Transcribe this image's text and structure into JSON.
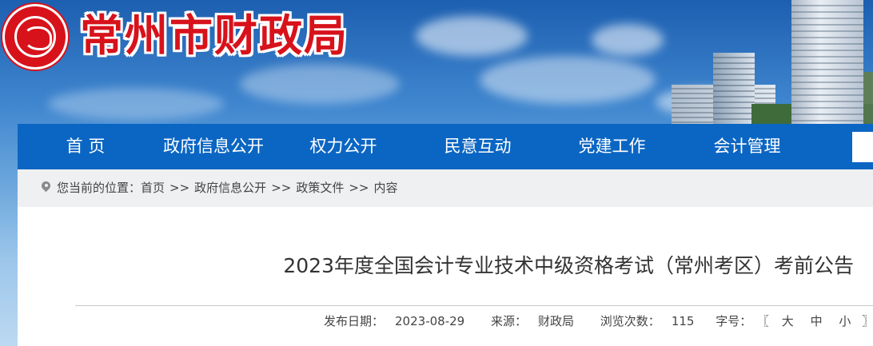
{
  "site": {
    "title": "常州市财政局",
    "logo": "dragon-seal-logo"
  },
  "nav": {
    "items": [
      {
        "label": "首 页"
      },
      {
        "label": "政府信息公开"
      },
      {
        "label": "权力公开"
      },
      {
        "label": "民意互动"
      },
      {
        "label": "党建工作"
      },
      {
        "label": "会计管理"
      }
    ],
    "color": "#0b66c3"
  },
  "breadcrumb": {
    "prefix": "您当前的位置：",
    "items": [
      "首页",
      "政府信息公开",
      "政策文件",
      "内容"
    ],
    "separator": ">>",
    "icon": "location-pin-icon"
  },
  "article": {
    "title": "2023年度全国会计专业技术中级资格考试（常州考区）考前公告",
    "meta": {
      "date_label": "发布日期：",
      "date": "2023-08-29",
      "source_label": "来源：",
      "source": "财政局",
      "views_label": "浏览次数：",
      "views": "115",
      "fontsize_label": "字号：",
      "bracket_open": "〖",
      "size_large": "大",
      "size_medium": "中",
      "size_small": "小",
      "bracket_close": "〗"
    }
  },
  "colors": {
    "brand_red": "#d7121b",
    "nav_blue": "#0b66c3"
  }
}
